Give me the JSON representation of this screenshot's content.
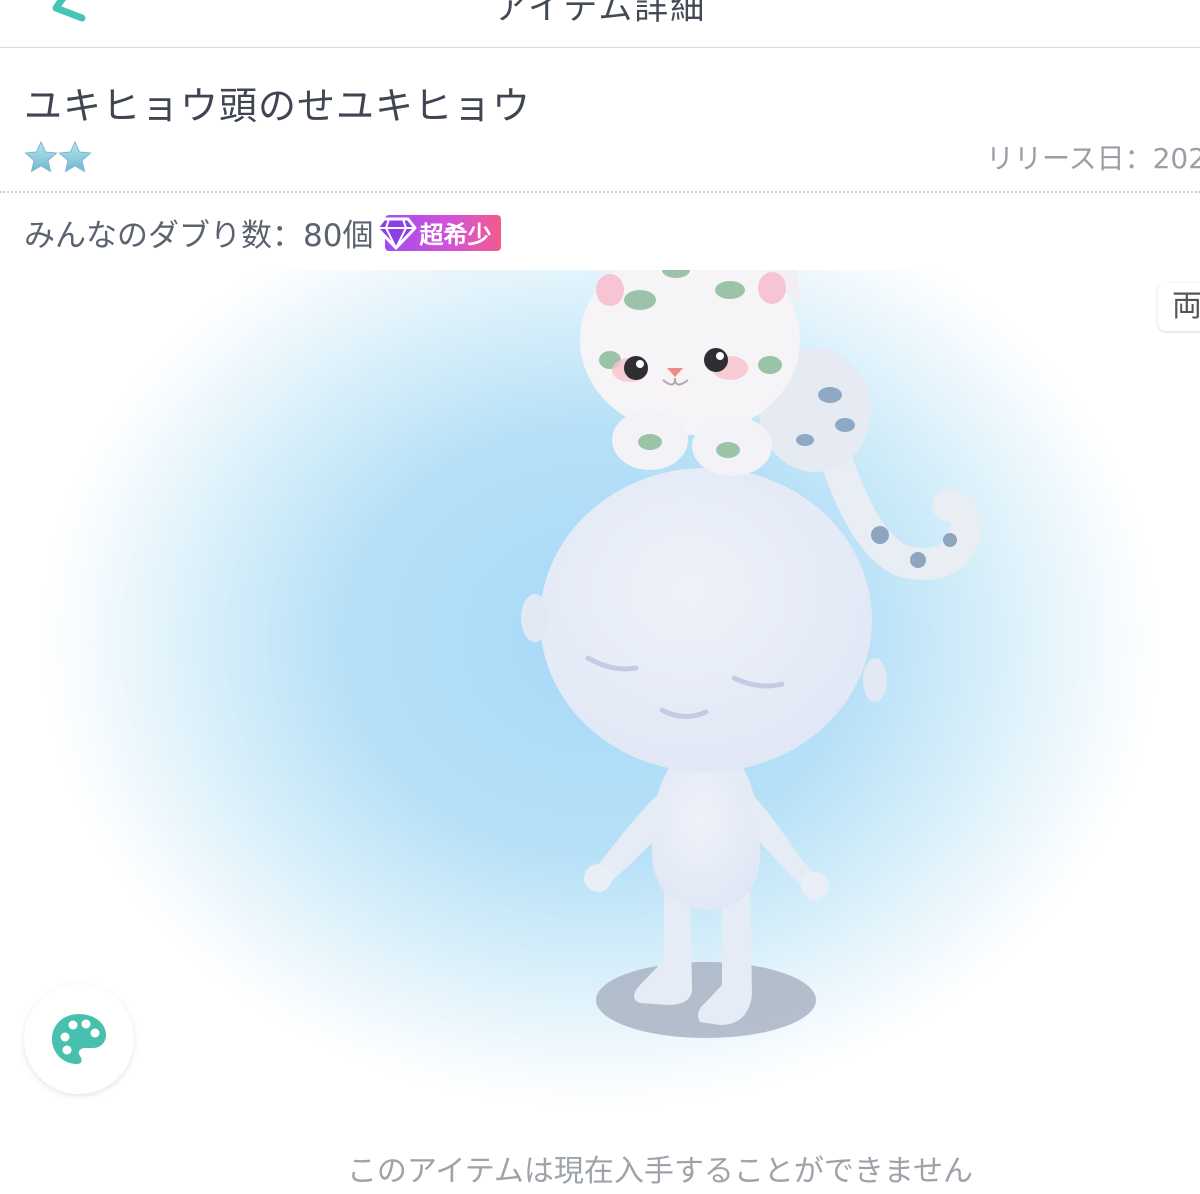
{
  "nav": {
    "title": "アイテム詳細",
    "back_icon": "chevron-left-icon"
  },
  "item": {
    "name": "ユキヒョウ頭のせユキヒョウ",
    "rarity_stars": 2,
    "release_label": "リリース日：202",
    "duplicate_text": "みんなのダブり数：80個",
    "badge_label": "超希少",
    "badge_icon": "diamond-icon"
  },
  "preview": {
    "edge_tab_label": "両",
    "palette_icon": "palette-icon"
  },
  "footer": {
    "note": "このアイテムは現在入手することができません"
  },
  "colors": {
    "accent_teal": "#3ec1b0",
    "badge_gradient_start": "#a24cf1",
    "badge_gradient_end": "#f25b8f",
    "star": "#8fcfe0"
  }
}
